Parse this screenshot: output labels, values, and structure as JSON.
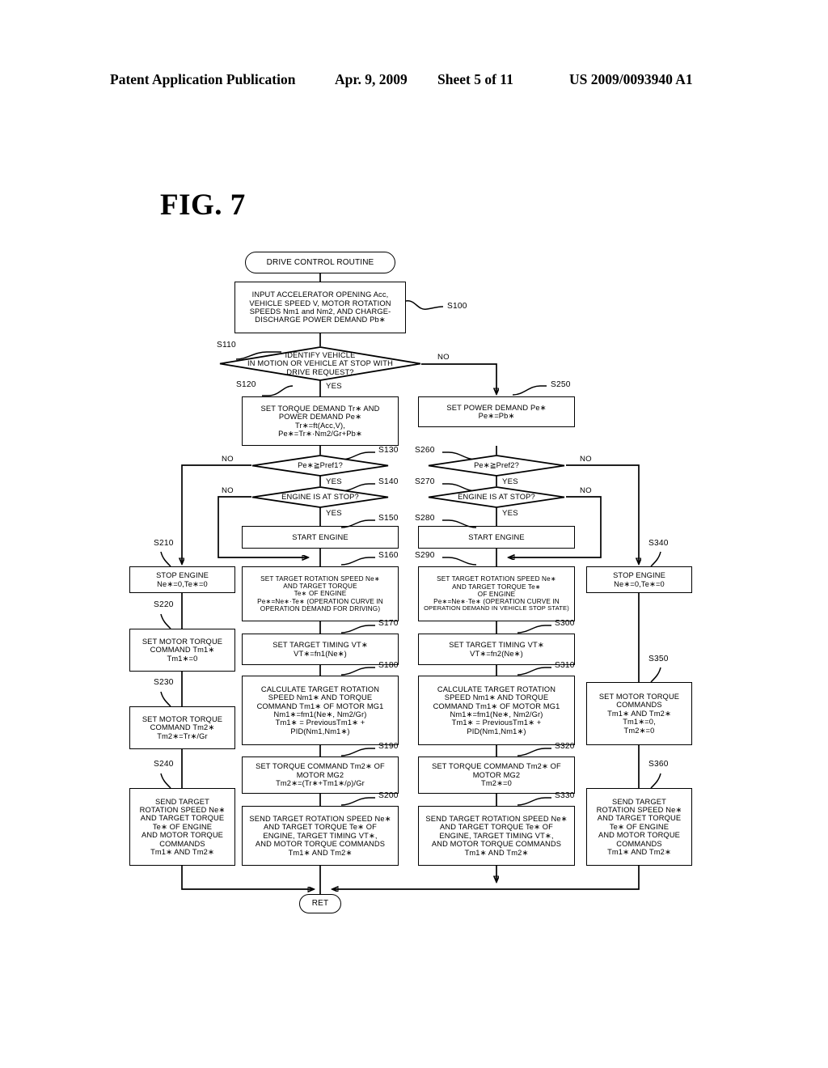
{
  "header": {
    "publication": "Patent Application Publication",
    "date": "Apr. 9, 2009",
    "sheet": "Sheet 5 of 11",
    "patent_number": "US 2009/0093940 A1"
  },
  "figure": {
    "title": "FIG. 7"
  },
  "flowchart": {
    "start": {
      "label": "DRIVE CONTROL ROUTINE"
    },
    "end": {
      "label": "RET"
    },
    "steps": {
      "S100": {
        "id": "S100",
        "lines": [
          "INPUT ACCELERATOR OPENING Acc,",
          "VEHICLE SPEED V, MOTOR ROTATION",
          "SPEEDS Nm1 and Nm2, AND CHARGE-",
          "DISCHARGE POWER DEMAND Pb∗"
        ]
      },
      "S110": {
        "id": "S110",
        "lines": [
          "IDENTIFY VEHICLE",
          "IN MOTION OR VEHICLE AT STOP WITH",
          "DRIVE REQUEST?"
        ],
        "yes": "YES",
        "no": "NO"
      },
      "S120": {
        "id": "S120",
        "lines": [
          "SET TORQUE DEMAND Tr∗ AND",
          "POWER DEMAND Pe∗",
          "Tr∗=ft(Acc,V),",
          "Pe∗=Tr∗·Nm2/Gr+Pb∗"
        ]
      },
      "S130": {
        "id": "S130",
        "lines": [
          "Pe∗≧Pref1?"
        ],
        "yes": "YES",
        "no": "NO"
      },
      "S140": {
        "id": "S140",
        "lines": [
          "ENGINE IS AT STOP?"
        ],
        "yes": "YES",
        "no": "NO"
      },
      "S150": {
        "id": "S150",
        "lines": [
          "START ENGINE"
        ]
      },
      "S160": {
        "id": "S160",
        "lines": [
          "SET TARGET ROTATION SPEED Ne∗",
          "AND TARGET TORQUE",
          "Te∗ OF ENGINE",
          "Pe∗=Ne∗·Te∗ (OPERATION CURVE IN",
          "OPERATION DEMAND FOR DRIVING)"
        ]
      },
      "S170": {
        "id": "S170",
        "lines": [
          "SET TARGET TIMING VT∗",
          "VT∗=fn1(Ne∗)"
        ]
      },
      "S180": {
        "id": "S180",
        "lines": [
          "CALCULATE TARGET ROTATION",
          "SPEED Nm1∗ AND TORQUE",
          "COMMAND Tm1∗ OF MOTOR MG1",
          "Nm1∗=fm1(Ne∗, Nm2/Gr)",
          "Tm1∗ = PreviousTm1∗ +",
          "PID(Nm1,Nm1∗)"
        ]
      },
      "S190": {
        "id": "S190",
        "lines": [
          "SET TORQUE COMMAND Tm2∗ OF",
          "MOTOR MG2",
          "Tm2∗=(Tr∗+Tm1∗/ρ)/Gr"
        ]
      },
      "S200": {
        "id": "S200",
        "lines": [
          "SEND TARGET ROTATION SPEED Ne∗",
          "AND TARGET TORQUE Te∗ OF",
          "ENGINE, TARGET TIMING VT∗,",
          "AND MOTOR TORQUE COMMANDS",
          "Tm1∗ AND Tm2∗"
        ]
      },
      "S210": {
        "id": "S210",
        "lines": [
          "STOP ENGINE",
          "Ne∗=0,Te∗=0"
        ]
      },
      "S220": {
        "id": "S220",
        "lines": [
          "SET MOTOR TORQUE",
          "COMMAND Tm1∗",
          "Tm1∗=0"
        ]
      },
      "S230": {
        "id": "S230",
        "lines": [
          "SET MOTOR TORQUE",
          "COMMAND Tm2∗",
          "Tm2∗=Tr∗/Gr"
        ]
      },
      "S240": {
        "id": "S240",
        "lines": [
          "SEND TARGET",
          "ROTATION SPEED Ne∗",
          "AND TARGET TORQUE",
          "Te∗ OF ENGINE",
          "AND MOTOR TORQUE",
          "COMMANDS",
          "Tm1∗ AND Tm2∗"
        ]
      },
      "S250": {
        "id": "S250",
        "lines": [
          "SET POWER DEMAND Pe∗",
          "Pe∗=Pb∗"
        ]
      },
      "S260": {
        "id": "S260",
        "lines": [
          "Pe∗≧Pref2?"
        ],
        "yes": "YES",
        "no": "NO"
      },
      "S270": {
        "id": "S270",
        "lines": [
          "ENGINE IS AT STOP?"
        ],
        "yes": "YES",
        "no": "NO"
      },
      "S280": {
        "id": "S280",
        "lines": [
          "START ENGINE"
        ]
      },
      "S290": {
        "id": "S290",
        "lines": [
          "SET TARGET ROTATION SPEED Ne∗",
          "AND TARGET TORQUE Te∗",
          "OF ENGINE",
          "Pe∗=Ne∗·Te∗ (OPERATION CURVE IN",
          "OPERATION DEMAND IN VEHICLE STOP STATE)"
        ]
      },
      "S300": {
        "id": "S300",
        "lines": [
          "SET TARGET TIMING VT∗",
          "VT∗=fn2(Ne∗)"
        ]
      },
      "S310": {
        "id": "S310",
        "lines": [
          "CALCULATE TARGET ROTATION",
          "SPEED Nm1∗ AND TORQUE",
          "COMMAND Tm1∗ OF MOTOR MG1",
          "Nm1∗=fm1(Ne∗, Nm2/Gr)",
          "Tm1∗ = PreviousTm1∗ +",
          "PID(Nm1,Nm1∗)"
        ]
      },
      "S320": {
        "id": "S320",
        "lines": [
          "SET TORQUE COMMAND Tm2∗ OF",
          "MOTOR MG2",
          "Tm2∗=0"
        ]
      },
      "S330": {
        "id": "S330",
        "lines": [
          "SEND TARGET ROTATION SPEED Ne∗",
          "AND TARGET TORQUE Te∗ OF",
          "ENGINE, TARGET TIMING VT∗,",
          "AND MOTOR TORQUE COMMANDS",
          "Tm1∗ AND Tm2∗"
        ]
      },
      "S340": {
        "id": "S340",
        "lines": [
          "STOP ENGINE",
          "Ne∗=0,Te∗=0"
        ]
      },
      "S350": {
        "id": "S350",
        "lines": [
          "SET MOTOR TORQUE",
          "COMMANDS",
          "Tm1∗ AND Tm2∗",
          "Tm1∗=0,",
          "Tm2∗=0"
        ]
      },
      "S360": {
        "id": "S360",
        "lines": [
          "SEND TARGET",
          "ROTATION SPEED Ne∗",
          "AND TARGET TORQUE",
          "Te∗ OF ENGINE",
          "AND MOTOR TORQUE",
          "COMMANDS",
          "Tm1∗ AND Tm2∗"
        ]
      }
    }
  }
}
